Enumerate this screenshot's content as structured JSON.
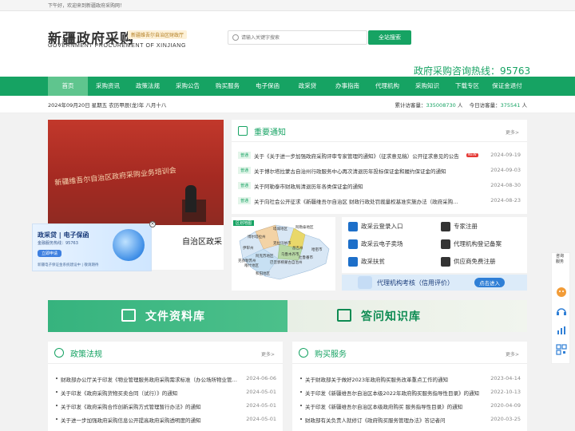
{
  "topbar": {
    "greeting": "下午好，欢迎来到新疆政府采购网！"
  },
  "header": {
    "logo_cn": "新疆政府采购",
    "logo_en": "GOVERNMENT PROCUREMENT OF XINJIANG",
    "logo_tag": "新疆维吾尔自治区财政厅",
    "search_placeholder": "请输入关键字搜索",
    "search_button": "全站搜索",
    "hotline": "政府采购咨询热线：95763"
  },
  "nav": {
    "items": [
      "首页",
      "采购资讯",
      "政策法规",
      "采购公告",
      "购买服务",
      "电子保函",
      "政采贷",
      "办事指南",
      "代理机构",
      "采购知识",
      "下载专区",
      "保证金退付"
    ]
  },
  "datebar": {
    "date": "2024年09月20日 星期五 农历甲辰(龙)年 八月十八",
    "total_label": "累计访客量：",
    "total_value": "335008730",
    "total_unit": "人",
    "today_label": "今日访客量：",
    "today_value": "375541",
    "today_unit": "人"
  },
  "banner": {
    "photo_title": "新疆维吾尔自治区政府采购业务培训会",
    "caption": "自治区政采"
  },
  "ad": {
    "title": "政采贷 | 电子保函",
    "hotline": "金融服务热线：95763",
    "button": "立即申请",
    "footer": "新疆电子保证金系统建设中 | 敬请期待"
  },
  "notice": {
    "title": "重要通知",
    "more": "更多>",
    "tag": "普通",
    "new_badge": "NEW",
    "items": [
      {
        "text": "关于《关于进一步加强政府采购评审专家管理的通知》（征求意见稿）公开征求意见的公告",
        "date": "2024-09-19"
      },
      {
        "text": "关于博尔塔拉蒙古自治州行政服务中心再次清退历年投标保证金和履约保证金的通知",
        "date": "2024-09-03"
      },
      {
        "text": "关于阿勒泰市财政局清退历年各类保证金的通知",
        "date": "2024-08-30"
      },
      {
        "text": "关于向社会公开征求《新疆维吾尔自治区 财政行政处罚裁量权基准实施办法（政府采购领域）》意见",
        "date": "2024-08-23"
      }
    ]
  },
  "map": {
    "label": "区划地图",
    "regions": [
      "博尔塔拉州",
      "塔城地区",
      "阿勒泰地区",
      "伊犁州",
      "克拉玛依市",
      "乌鲁木齐市",
      "昌吉州",
      "吐鲁番市",
      "哈密市",
      "巴音郭楞蒙古自治州",
      "阿克苏地区",
      "克孜勒苏州",
      "喀什地区",
      "和田地区"
    ]
  },
  "quick_links": {
    "items": [
      "政采云登录入口",
      "专家注册",
      "政采云电子卖场",
      "代理机构登记备案",
      "政采扶贫",
      "供应商免费注册"
    ]
  },
  "daili": {
    "text": "代理机构考核（信用评价）",
    "button": "点击进入"
  },
  "strip": {
    "left": "文件资料库",
    "right": "答问知识库"
  },
  "policy": {
    "title": "政策法规",
    "more": "更多>",
    "items": [
      {
        "text": "财政部办公厅关于印发《物业管理服务政府采购需求标准（办公场所物业管理服务项目）》的通知",
        "date": "2024-06-06"
      },
      {
        "text": "关于印发《政府采购货物买卖合同（试行）》的通知",
        "date": "2024-05-01"
      },
      {
        "text": "关于印发《政府采购合作创新采购方式管理暂行办法》的通知",
        "date": "2024-05-01"
      },
      {
        "text": "关于进一步加强政府采购信息公开提高政府采购透明度的通知",
        "date": "2024-05-01"
      }
    ]
  },
  "purchase": {
    "title": "购买服务",
    "more": "更多>",
    "items": [
      {
        "text": "关于财政部关于做好2023年政府购买服务改革重点工作的通知",
        "date": "2023-04-14"
      },
      {
        "text": "关于印发《新疆维吾尔自治区本级2022年政府购买服务指导性目录》的通知",
        "date": "2022-10-13"
      },
      {
        "text": "关于印发《新疆维吾尔自治区本级政府购买 服务指导性目录》的通知",
        "date": "2020-04-09"
      },
      {
        "text": "财政部有关负责人就修订《政府购买服务管理办法》答记者问",
        "date": "2020-03-25"
      }
    ]
  },
  "float": {
    "consult": "咨询",
    "consult2": "服务"
  }
}
